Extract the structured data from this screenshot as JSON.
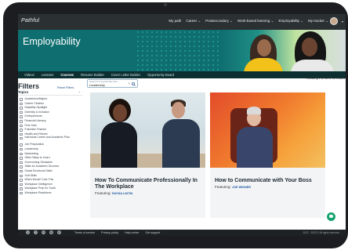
{
  "app": {
    "logo": "Pathful"
  },
  "topnav": {
    "items": [
      "My path",
      "Career ⌄",
      "Postsecondary ⌄",
      "Work-based learning ⌄",
      "Employability ⌄",
      "My tracker ⌄"
    ]
  },
  "hero": {
    "title": "Employability"
  },
  "subnav": {
    "tabs": [
      "Videos",
      "Lessons",
      "Courses",
      "Resume Builder",
      "Cover Letter Builder",
      "Opportunity Board"
    ],
    "active": "Courses"
  },
  "filters": {
    "title": "Filters",
    "reset_label": "Reset Filters",
    "topics_label": "Topics",
    "topics": [
      "Academics/Majors",
      "Career Clusters",
      "Disability Spotlight",
      "Diversity & Inclusion",
      "Entrepreneurs",
      "Financial Literacy",
      "First Jobs",
      "Futuristic Finance",
      "Health and Fitness",
      "Individual Career and Academic Plan",
      "Job Preparation",
      "Leadership",
      "Networking",
      "Other Ways to Learn",
      "Overcoming Obstacles",
      "Skills for Academic Success",
      "Social Emotional Skills",
      "Soft Skills",
      "When Would I Use This",
      "Workplace Intelligence",
      "Workplace Prep for Youth",
      "Workplace Readiness"
    ]
  },
  "search": {
    "placeholder": "Search for keyword(s) here",
    "value": "Leadership"
  },
  "results": {
    "showing": "Showing 1 to 18 of 18 results"
  },
  "cards": [
    {
      "title": "How To Communicate Professionally In The Workplace",
      "featuring_label": "Featuring:",
      "featuring_name": "RAYNA LINTIN"
    },
    {
      "title": "How to Communicate with Your Boss",
      "featuring_label": "Featuring:",
      "featuring_name": "JOE WIDNER"
    }
  ],
  "footer": {
    "socials": [
      "y",
      "f",
      "in",
      "ig",
      "yt"
    ],
    "links": [
      "Terms of service",
      "Privacy policy",
      "Help center",
      "Get support"
    ],
    "copyright": "2022 - 2023 © All rights reserved"
  },
  "colors": {
    "accent": "#0f6e70",
    "link": "#1d5aa5",
    "chat": "#18a36f"
  }
}
